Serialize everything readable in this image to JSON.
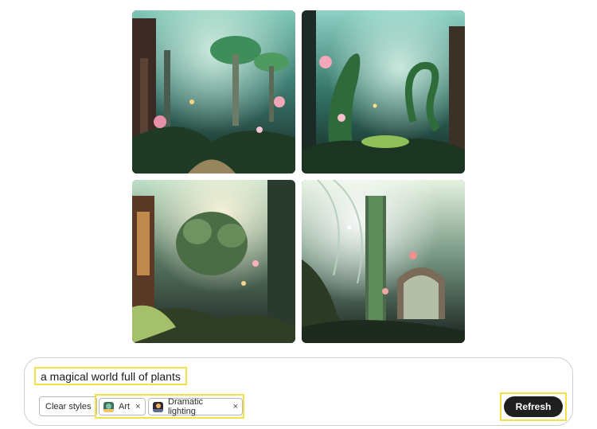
{
  "prompt": {
    "text": "a magical world full of plants"
  },
  "controls": {
    "clear_styles_label": "Clear styles",
    "refresh_label": "Refresh"
  },
  "style_tags": [
    {
      "label": "Art",
      "remove_glyph": "×",
      "icon": "art-thumbnail"
    },
    {
      "label": "Dramatic lighting",
      "remove_glyph": "×",
      "icon": "dramatic-lighting-thumbnail"
    }
  ],
  "images": [
    {
      "name": "generated-image-1",
      "palette": [
        "#1d3a38",
        "#6bb6a0",
        "#e28aa6"
      ]
    },
    {
      "name": "generated-image-2",
      "palette": [
        "#1a3431",
        "#4ba79a",
        "#f0a1b2"
      ]
    },
    {
      "name": "generated-image-3",
      "palette": [
        "#22302a",
        "#a7b98a",
        "#e9b16a"
      ]
    },
    {
      "name": "generated-image-4",
      "palette": [
        "#1e2d28",
        "#c8d9b8",
        "#e58b86"
      ]
    }
  ],
  "colors": {
    "highlight": "#f2e14a",
    "refresh_bg": "#1f1f1f"
  }
}
